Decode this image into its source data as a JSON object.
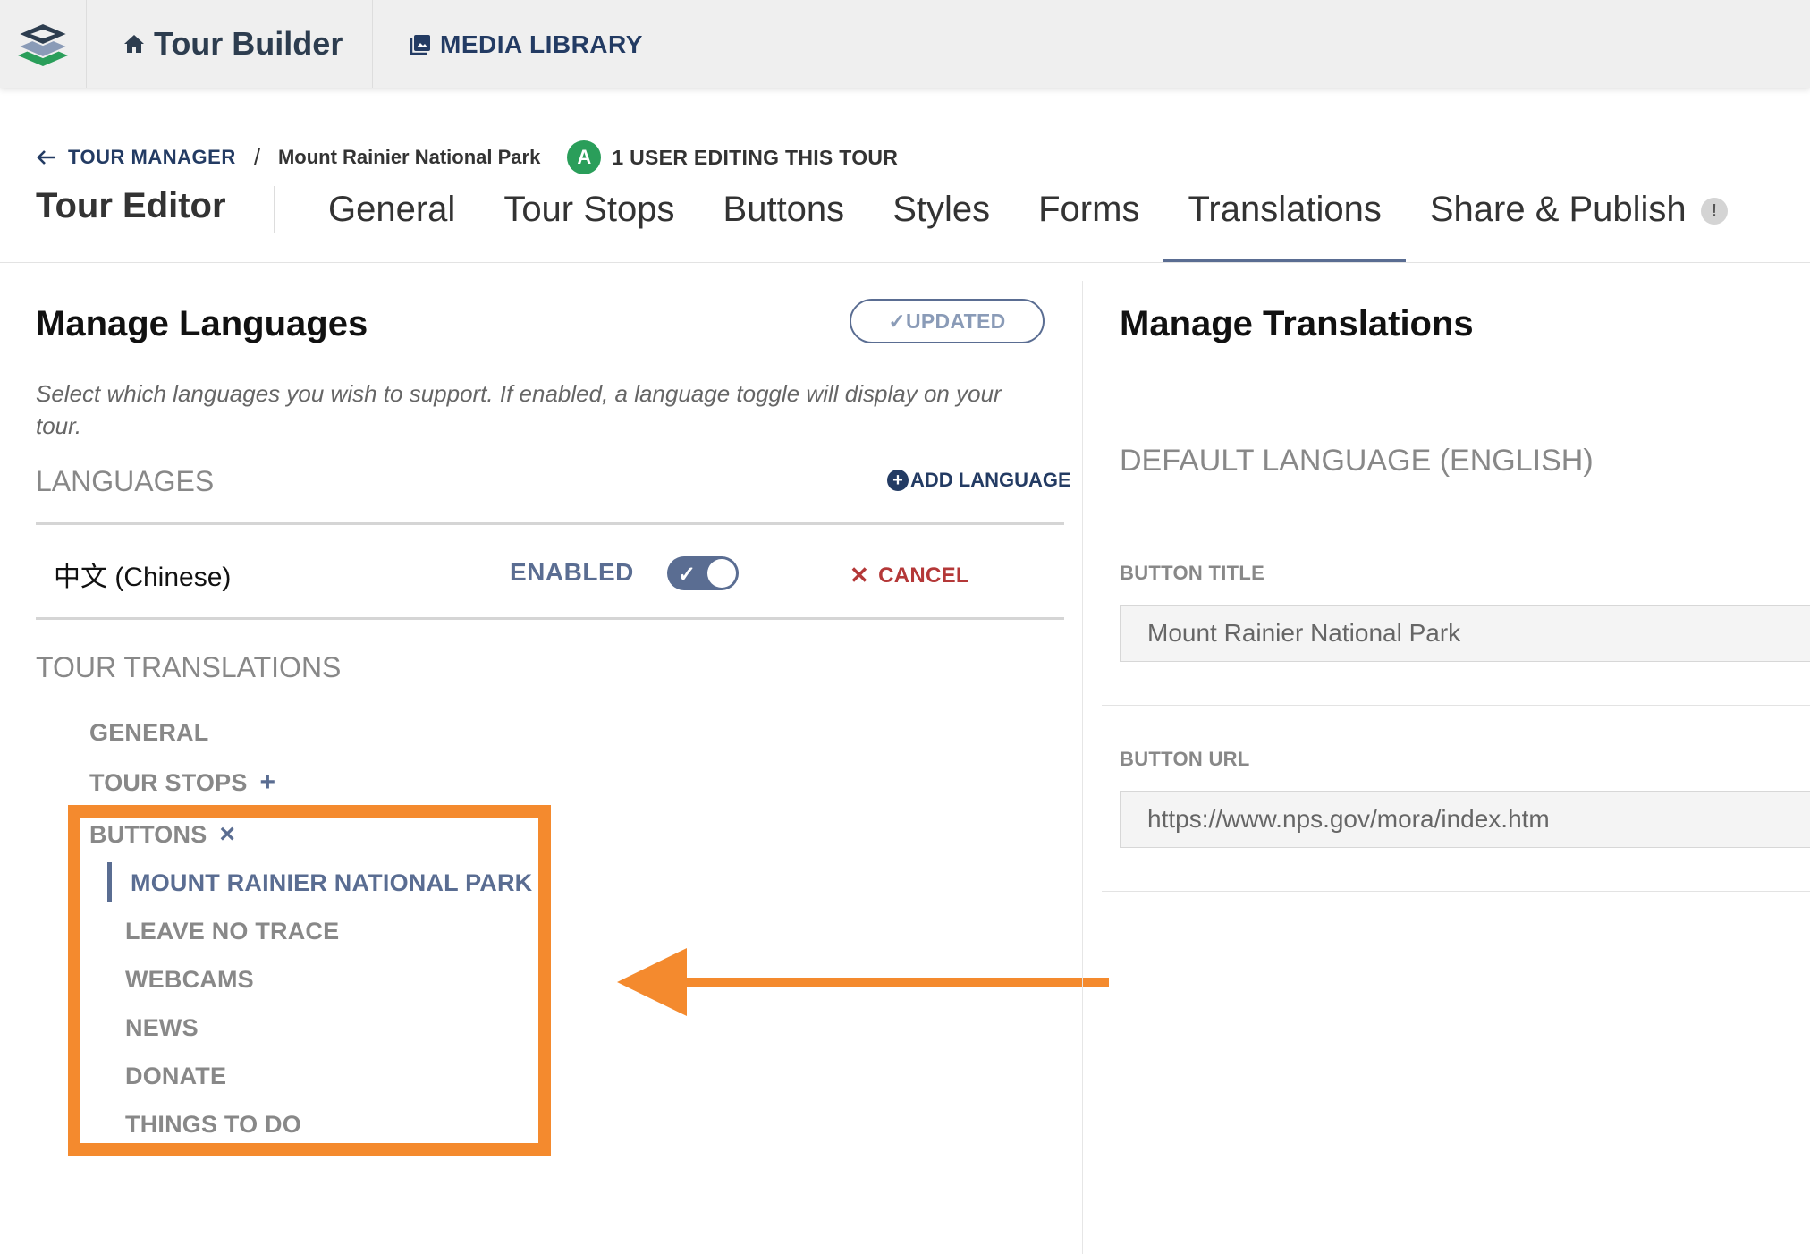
{
  "topbar": {
    "brand": "Tour Builder",
    "media_library": "MEDIA LIBRARY"
  },
  "breadcrumb": {
    "back_label": "TOUR MANAGER",
    "separator": "/",
    "current": "Mount Rainier National Park",
    "user_initial": "A",
    "user_editing": "1 USER EDITING THIS TOUR"
  },
  "editor": {
    "title": "Tour Editor",
    "tabs": [
      "General",
      "Tour Stops",
      "Buttons",
      "Styles",
      "Forms",
      "Translations",
      "Share & Publish"
    ],
    "active_tab": "Translations",
    "share_badge": "!"
  },
  "languages_panel": {
    "title": "Manage Languages",
    "updated_label": "✓UPDATED",
    "description": "Select which languages you wish to support. If enabled, a language toggle will display on your tour.",
    "languages_header": "LANGUAGES",
    "add_language": "ADD LANGUAGE",
    "language_name": "中文 (Chinese)",
    "enabled_label": "ENABLED",
    "toggle_on": true,
    "cancel_label": "CANCEL",
    "tour_translations_header": "TOUR TRANSLATIONS",
    "tree": {
      "general": "GENERAL",
      "tour_stops": "TOUR STOPS",
      "tour_stops_symbol": "+",
      "buttons": "BUTTONS",
      "buttons_symbol": "×",
      "button_items": [
        "MOUNT RAINIER NATIONAL PARK",
        "LEAVE NO TRACE",
        "WEBCAMS",
        "NEWS",
        "DONATE",
        "THINGS TO DO"
      ],
      "active_button": "MOUNT RAINIER NATIONAL PARK"
    }
  },
  "translations_panel": {
    "title": "Manage Translations",
    "default_language": "DEFAULT LANGUAGE (ENGLISH)",
    "button_title_label": "BUTTON TITLE",
    "button_title_value": "Mount Rainier National Park",
    "button_url_label": "BUTTON URL",
    "button_url_value": "https://www.nps.gov/mora/index.htm"
  },
  "colors": {
    "accent": "#5a6d92",
    "navy": "#233b63",
    "highlight": "#f48a2e",
    "cancel": "#b43838",
    "user_badge": "#2a9e5a"
  }
}
